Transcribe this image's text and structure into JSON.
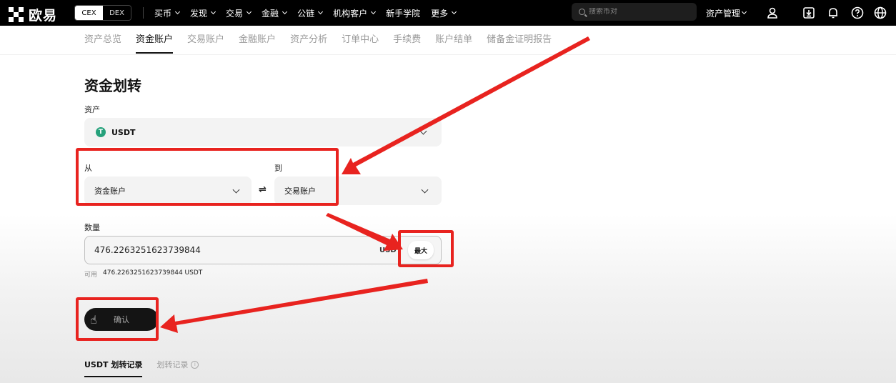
{
  "header": {
    "logo_text": "欧易",
    "mode_cex": "CEX",
    "mode_dex": "DEX",
    "nav": [
      {
        "label": "买币",
        "has_menu": true
      },
      {
        "label": "发现",
        "has_menu": true
      },
      {
        "label": "交易",
        "has_menu": true
      },
      {
        "label": "金融",
        "has_menu": true
      },
      {
        "label": "公链",
        "has_menu": true
      },
      {
        "label": "机构客户",
        "has_menu": true
      },
      {
        "label": "新手学院",
        "has_menu": false
      },
      {
        "label": "更多",
        "has_menu": true
      }
    ],
    "search_placeholder": "搜索币对",
    "asset_management": "资产管理",
    "icons": [
      "user-icon",
      "download-icon",
      "bell-icon",
      "help-icon",
      "globe-icon"
    ]
  },
  "subnav": {
    "tabs": [
      "资产总览",
      "资金账户",
      "交易账户",
      "金融账户",
      "资产分析",
      "订单中心",
      "手续费",
      "账户结单",
      "储备金证明报告"
    ],
    "active_index": 1
  },
  "form": {
    "title": "资金划转",
    "asset_label": "资产",
    "asset_value": "USDT",
    "asset_icon_letter": "T",
    "from_label": "从",
    "from_value": "资金账户",
    "to_label": "到",
    "to_value": "交易账户",
    "swap_symbol": "⇌",
    "amount_label": "数量",
    "amount_value": "476.2263251623739844",
    "amount_unit": "USD",
    "max_label": "最大",
    "available_label": "可用",
    "available_value": "476.2263251623739844 USDT",
    "confirm_label": "确认"
  },
  "records": {
    "tabs": [
      "USDT 划转记录",
      "划转记录"
    ]
  },
  "colors": {
    "annotation_red": "#e8231f",
    "usdt_green": "#26a17b",
    "nav_bg": "#000000"
  }
}
